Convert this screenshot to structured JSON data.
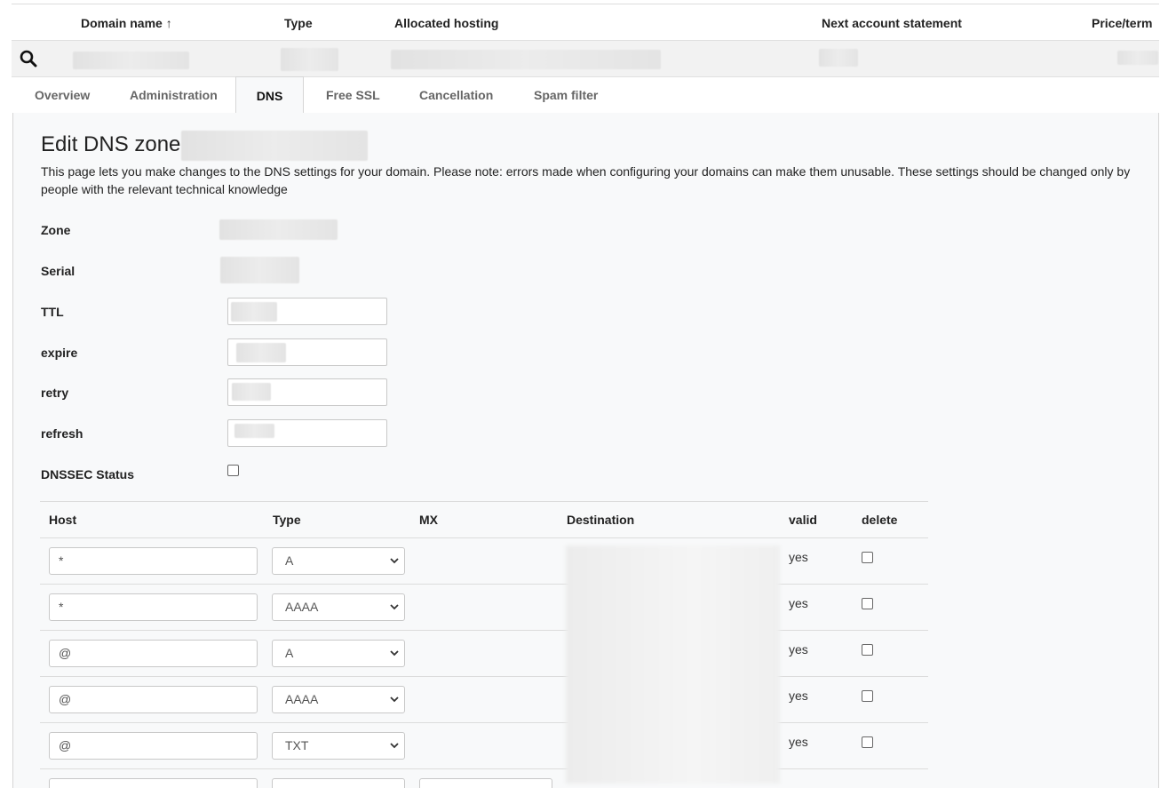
{
  "domain_table": {
    "headers": {
      "domain_name": "Domain name",
      "type": "Type",
      "allocated_hosting": "Allocated hosting",
      "next_statement": "Next account statement",
      "price_term": "Price/term"
    },
    "sort_indicator": "↑"
  },
  "tabs": [
    {
      "label": "Overview"
    },
    {
      "label": "Administration"
    },
    {
      "label": "DNS"
    },
    {
      "label": "Free SSL"
    },
    {
      "label": "Cancellation"
    },
    {
      "label": "Spam filter"
    }
  ],
  "active_tab": "DNS",
  "panel": {
    "title": "Edit DNS zone",
    "description": "This page lets you make changes to the DNS settings for your domain. Please note: errors made when configuring your domains can make them unusable. These settings should be changed only by people with the relevant technical knowledge"
  },
  "fields": {
    "zone_label": "Zone",
    "serial_label": "Serial",
    "ttl_label": "TTL",
    "expire_label": "expire",
    "retry_label": "retry",
    "refresh_label": "refresh",
    "dnssec_label": "DNSSEC Status"
  },
  "records": {
    "headers": {
      "host": "Host",
      "type": "Type",
      "mx": "MX",
      "destination": "Destination",
      "valid": "valid",
      "delete": "delete"
    },
    "rows": [
      {
        "host": "*",
        "type": "A",
        "valid": "yes"
      },
      {
        "host": "*",
        "type": "AAAA",
        "valid": "yes"
      },
      {
        "host": "@",
        "type": "A",
        "valid": "yes"
      },
      {
        "host": "@",
        "type": "AAAA",
        "valid": "yes"
      },
      {
        "host": "@",
        "type": "TXT",
        "valid": "yes"
      }
    ]
  },
  "icons": {
    "search": "search-icon",
    "select_arrow": "chevron-down-icon",
    "sort": "arrow-up-icon"
  },
  "colors": {
    "panel_bg": "#f8f9fa",
    "search_row_bg": "#f2f2f2",
    "border": "#d6d6d6"
  }
}
